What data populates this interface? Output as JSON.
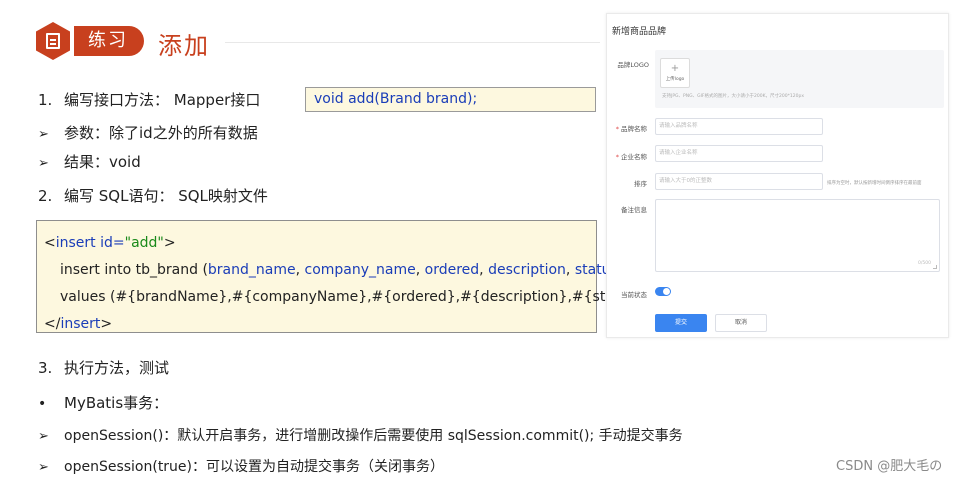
{
  "header": {
    "badge_icon": "document-icon",
    "badge_label": "练习",
    "title": "添加",
    "accent_color": "#c8401e"
  },
  "items": {
    "step1": {
      "num": "1.",
      "text": "编写接口方法： Mapper接口"
    },
    "step1_code": "void add(Brand brand);",
    "param": {
      "marker": "➢",
      "text": "参数：除了id之外的所有数据"
    },
    "result": {
      "marker": "➢",
      "text": "结果：void"
    },
    "step2": {
      "num": "2.",
      "text": "编写 SQL语句： SQL映射文件"
    },
    "step3": {
      "num": "3.",
      "text": "执行方法，测试"
    },
    "mybatis": {
      "marker": "•",
      "text": "MyBatis事务："
    },
    "open1": {
      "marker": "➢",
      "text": "openSession()：默认开启事务，进行增删改操作后需要使用 sqlSession.commit(); 手动提交事务"
    },
    "open2": {
      "marker": "➢",
      "text": "openSession(true)：可以设置为自动提交事务（关闭事务）"
    }
  },
  "code": {
    "line1_open": "<",
    "line1_tag": "insert",
    "line1_attr": " id=",
    "line1_val": "\"add\"",
    "line1_close": ">",
    "line2_prefix": "insert into tb_brand (",
    "cols": [
      "brand_name",
      "company_name",
      "ordered",
      "description",
      "status"
    ],
    "line2_suffix": ")",
    "line3": "values (#{brandName},#{companyName},#{ordered},#{description},#{status});",
    "line4_open": "</",
    "line4_tag": "insert",
    "line4_close": ">"
  },
  "form": {
    "title": "新增商品品牌",
    "logo_label": "品牌LOGO",
    "upload_plus": "+",
    "upload_text": "上传logo",
    "logo_tip": "支持JPG、PNG、GIF格式的图片，大小请小于200K，尺寸200*120px",
    "brand_label": "品牌名称",
    "brand_placeholder": "请输入品牌名称",
    "company_label": "企业名称",
    "company_placeholder": "请输入企业名称",
    "order_label": "排序",
    "order_placeholder": "请输入大于0的正整数",
    "order_tip": "排序为空时，默认按新增时间倒序排序在最前面",
    "desc_label": "备注信息",
    "desc_count": "0/500",
    "status_label": "当前状态",
    "submit_label": "提交",
    "cancel_label": "取消"
  },
  "watermark": "CSDN @肥大毛の"
}
